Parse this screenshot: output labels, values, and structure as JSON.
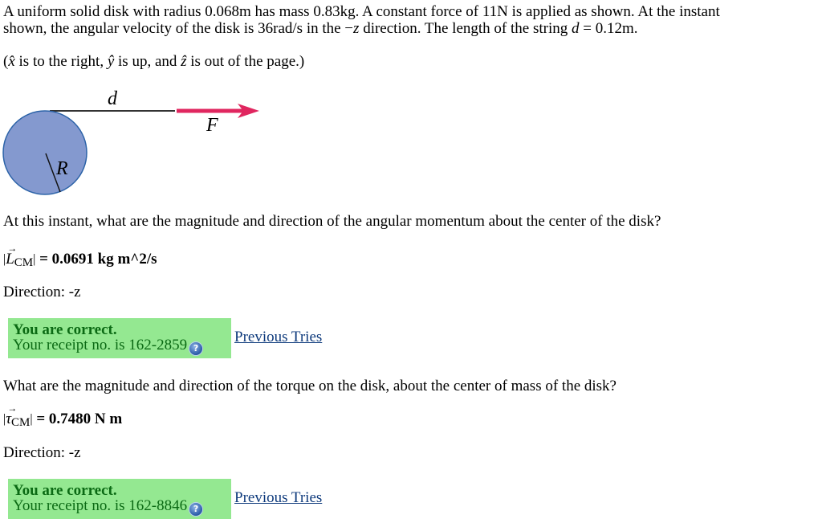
{
  "problem": {
    "line1": "A uniform solid disk with radius 0.068m has mass 0.83kg. A constant force of 11N is applied as shown. At the instant",
    "line2_pre": "shown, the angular velocity of the disk is 36rad/s in the −",
    "line2_z": "z",
    "line2_mid": " direction. The length of the string ",
    "line2_d": "d",
    "line2_post": " = 0.12m.",
    "axes_note": {
      "open": "(",
      "x": "x̂",
      "t1": " is to the right, ",
      "y": "ŷ",
      "t2": " is up, and ",
      "z": "ẑ",
      "t3": " is out of the page.)"
    }
  },
  "diagram": {
    "label_d": "d",
    "label_F": "F",
    "label_R": "R",
    "disk_color": "#8499cf",
    "disk_edge": "#2c63a8",
    "arrow_color": "#e0265f"
  },
  "questions": [
    {
      "prompt": "At this instant, what are the magnitude and direction of the angular momentum about the center of the disk?",
      "symbol": "L",
      "subscript": "CM",
      "answer": " = 0.0691 kg m^2/s",
      "direction": "Direction: -z",
      "feedback_title": "You are correct.",
      "receipt": "Your receipt no. is 162-2859",
      "previous_tries": "Previous Tries"
    },
    {
      "prompt": "What are the magnitude and direction of the torque on the disk, about the center of mass of the disk?",
      "symbol": "τ",
      "subscript": "CM",
      "answer": " = 0.7480 N m",
      "direction": "Direction: -z",
      "feedback_title": "You are correct.",
      "receipt": "Your receipt no. is 162-8846",
      "previous_tries": "Previous Tries"
    }
  ],
  "icons": {
    "help": "?"
  },
  "colors": {
    "feedback_bg": "#94e891",
    "feedback_text": "#0b6a14",
    "link": "#0e3a7c"
  }
}
